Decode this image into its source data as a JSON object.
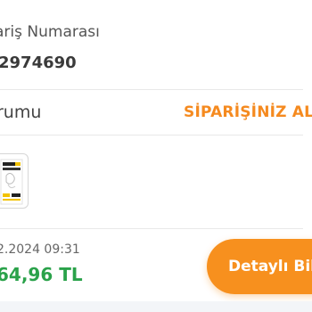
{
  "order": {
    "label": "ariş Numarası",
    "number": "2974690",
    "status_label": "rumu",
    "status_value": "SİPARİŞİNİZ ALI",
    "date": "2.2024 09:31",
    "price": "64,96 TL",
    "detail_button_label": "Detaylı Bilg"
  },
  "colors": {
    "accent_orange": "#f7901e",
    "status_orange": "#f58a1f",
    "price_green": "#2aa24a"
  }
}
